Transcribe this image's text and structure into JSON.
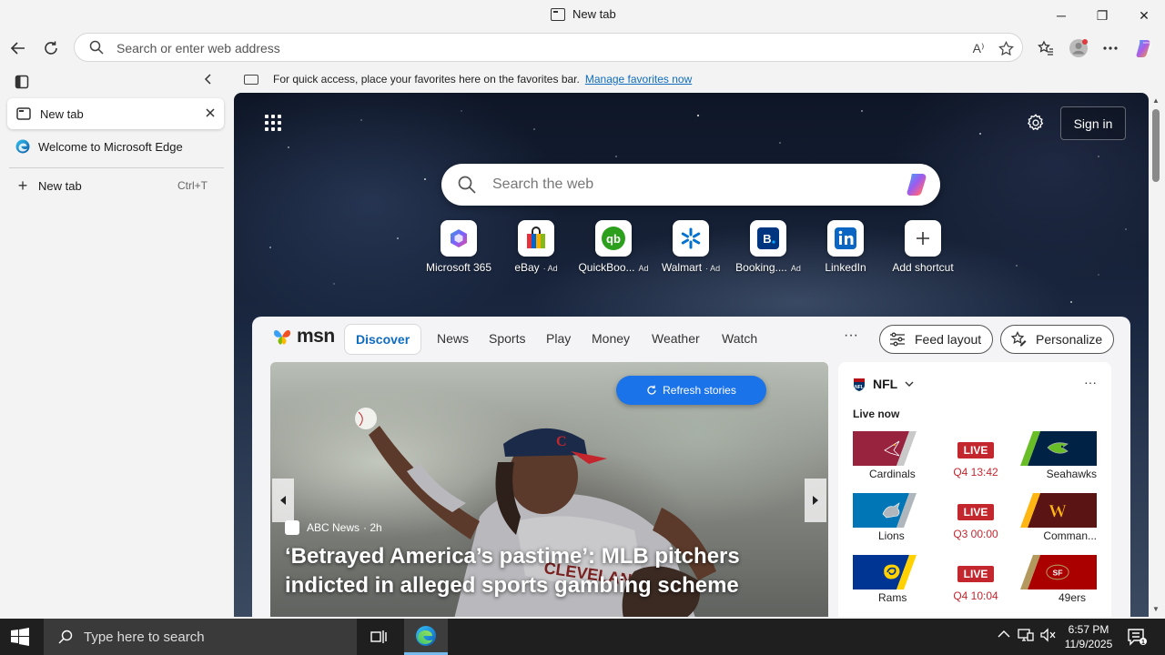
{
  "window": {
    "title": "New tab",
    "controls": {
      "minimize": "─",
      "maximize": "❐",
      "close": "✕"
    }
  },
  "address_bar": {
    "placeholder": "Search or enter web address",
    "read_aloud_icon": "A⁾"
  },
  "favorites_bar": {
    "message": "For quick access, place your favorites here on the favorites bar.",
    "link": "Manage favorites now"
  },
  "sidebar": {
    "tabs": [
      {
        "label": "New tab",
        "active": true,
        "icon": "new-tab-icon"
      },
      {
        "label": "Welcome to Microsoft Edge",
        "active": false,
        "icon": "edge-icon"
      }
    ],
    "new_tab": {
      "label": "New tab",
      "shortcut": "Ctrl+T"
    }
  },
  "newtab_page": {
    "sign_in": "Sign in",
    "search_placeholder": "Search the web",
    "shortcuts": [
      {
        "label": "Microsoft 365",
        "ad": ""
      },
      {
        "label": "eBay",
        "ad": "· Ad"
      },
      {
        "label": "QuickBoo...",
        "ad": "Ad"
      },
      {
        "label": "Walmart",
        "ad": "· Ad"
      },
      {
        "label": "Booking....",
        "ad": "Ad"
      },
      {
        "label": "LinkedIn",
        "ad": ""
      },
      {
        "label": "Add shortcut",
        "ad": ""
      }
    ]
  },
  "msn": {
    "logo_text": "msn",
    "nav": [
      "Discover",
      "News",
      "Sports",
      "Play",
      "Money",
      "Weather",
      "Watch"
    ],
    "active_nav": "Discover",
    "more": "···",
    "feed_layout": "Feed layout",
    "personalize": "Personalize",
    "refresh": "Refresh stories",
    "hero": {
      "source": "ABC News",
      "age": "· 2h",
      "title": "‘Betrayed America’s pastime’: MLB pitchers indicted in alleged sports gambling scheme"
    },
    "nfl": {
      "title": "NFL",
      "more": "···",
      "live_now": "Live now",
      "games": [
        {
          "home": "Cardinals",
          "away": "Seahawks",
          "status": "LIVE",
          "clock": "Q4 13:42",
          "home_color": "#97233f",
          "away_color": "#002244"
        },
        {
          "home": "Lions",
          "away": "Comman...",
          "status": "LIVE",
          "clock": "Q3 00:00",
          "home_color": "#0076b6",
          "away_color": "#5a1414"
        },
        {
          "home": "Rams",
          "away": "49ers",
          "status": "LIVE",
          "clock": "Q4 10:04",
          "home_color": "#003594",
          "away_color": "#aa0000"
        }
      ]
    }
  },
  "taskbar": {
    "search_placeholder": "Type here to search",
    "time": "6:57 PM",
    "date": "11/9/2025"
  },
  "colors": {
    "accent": "#0f6cbd",
    "live": "#c4262e",
    "refresh_button": "#1a73e8",
    "taskbar": "#1f1f1f"
  }
}
